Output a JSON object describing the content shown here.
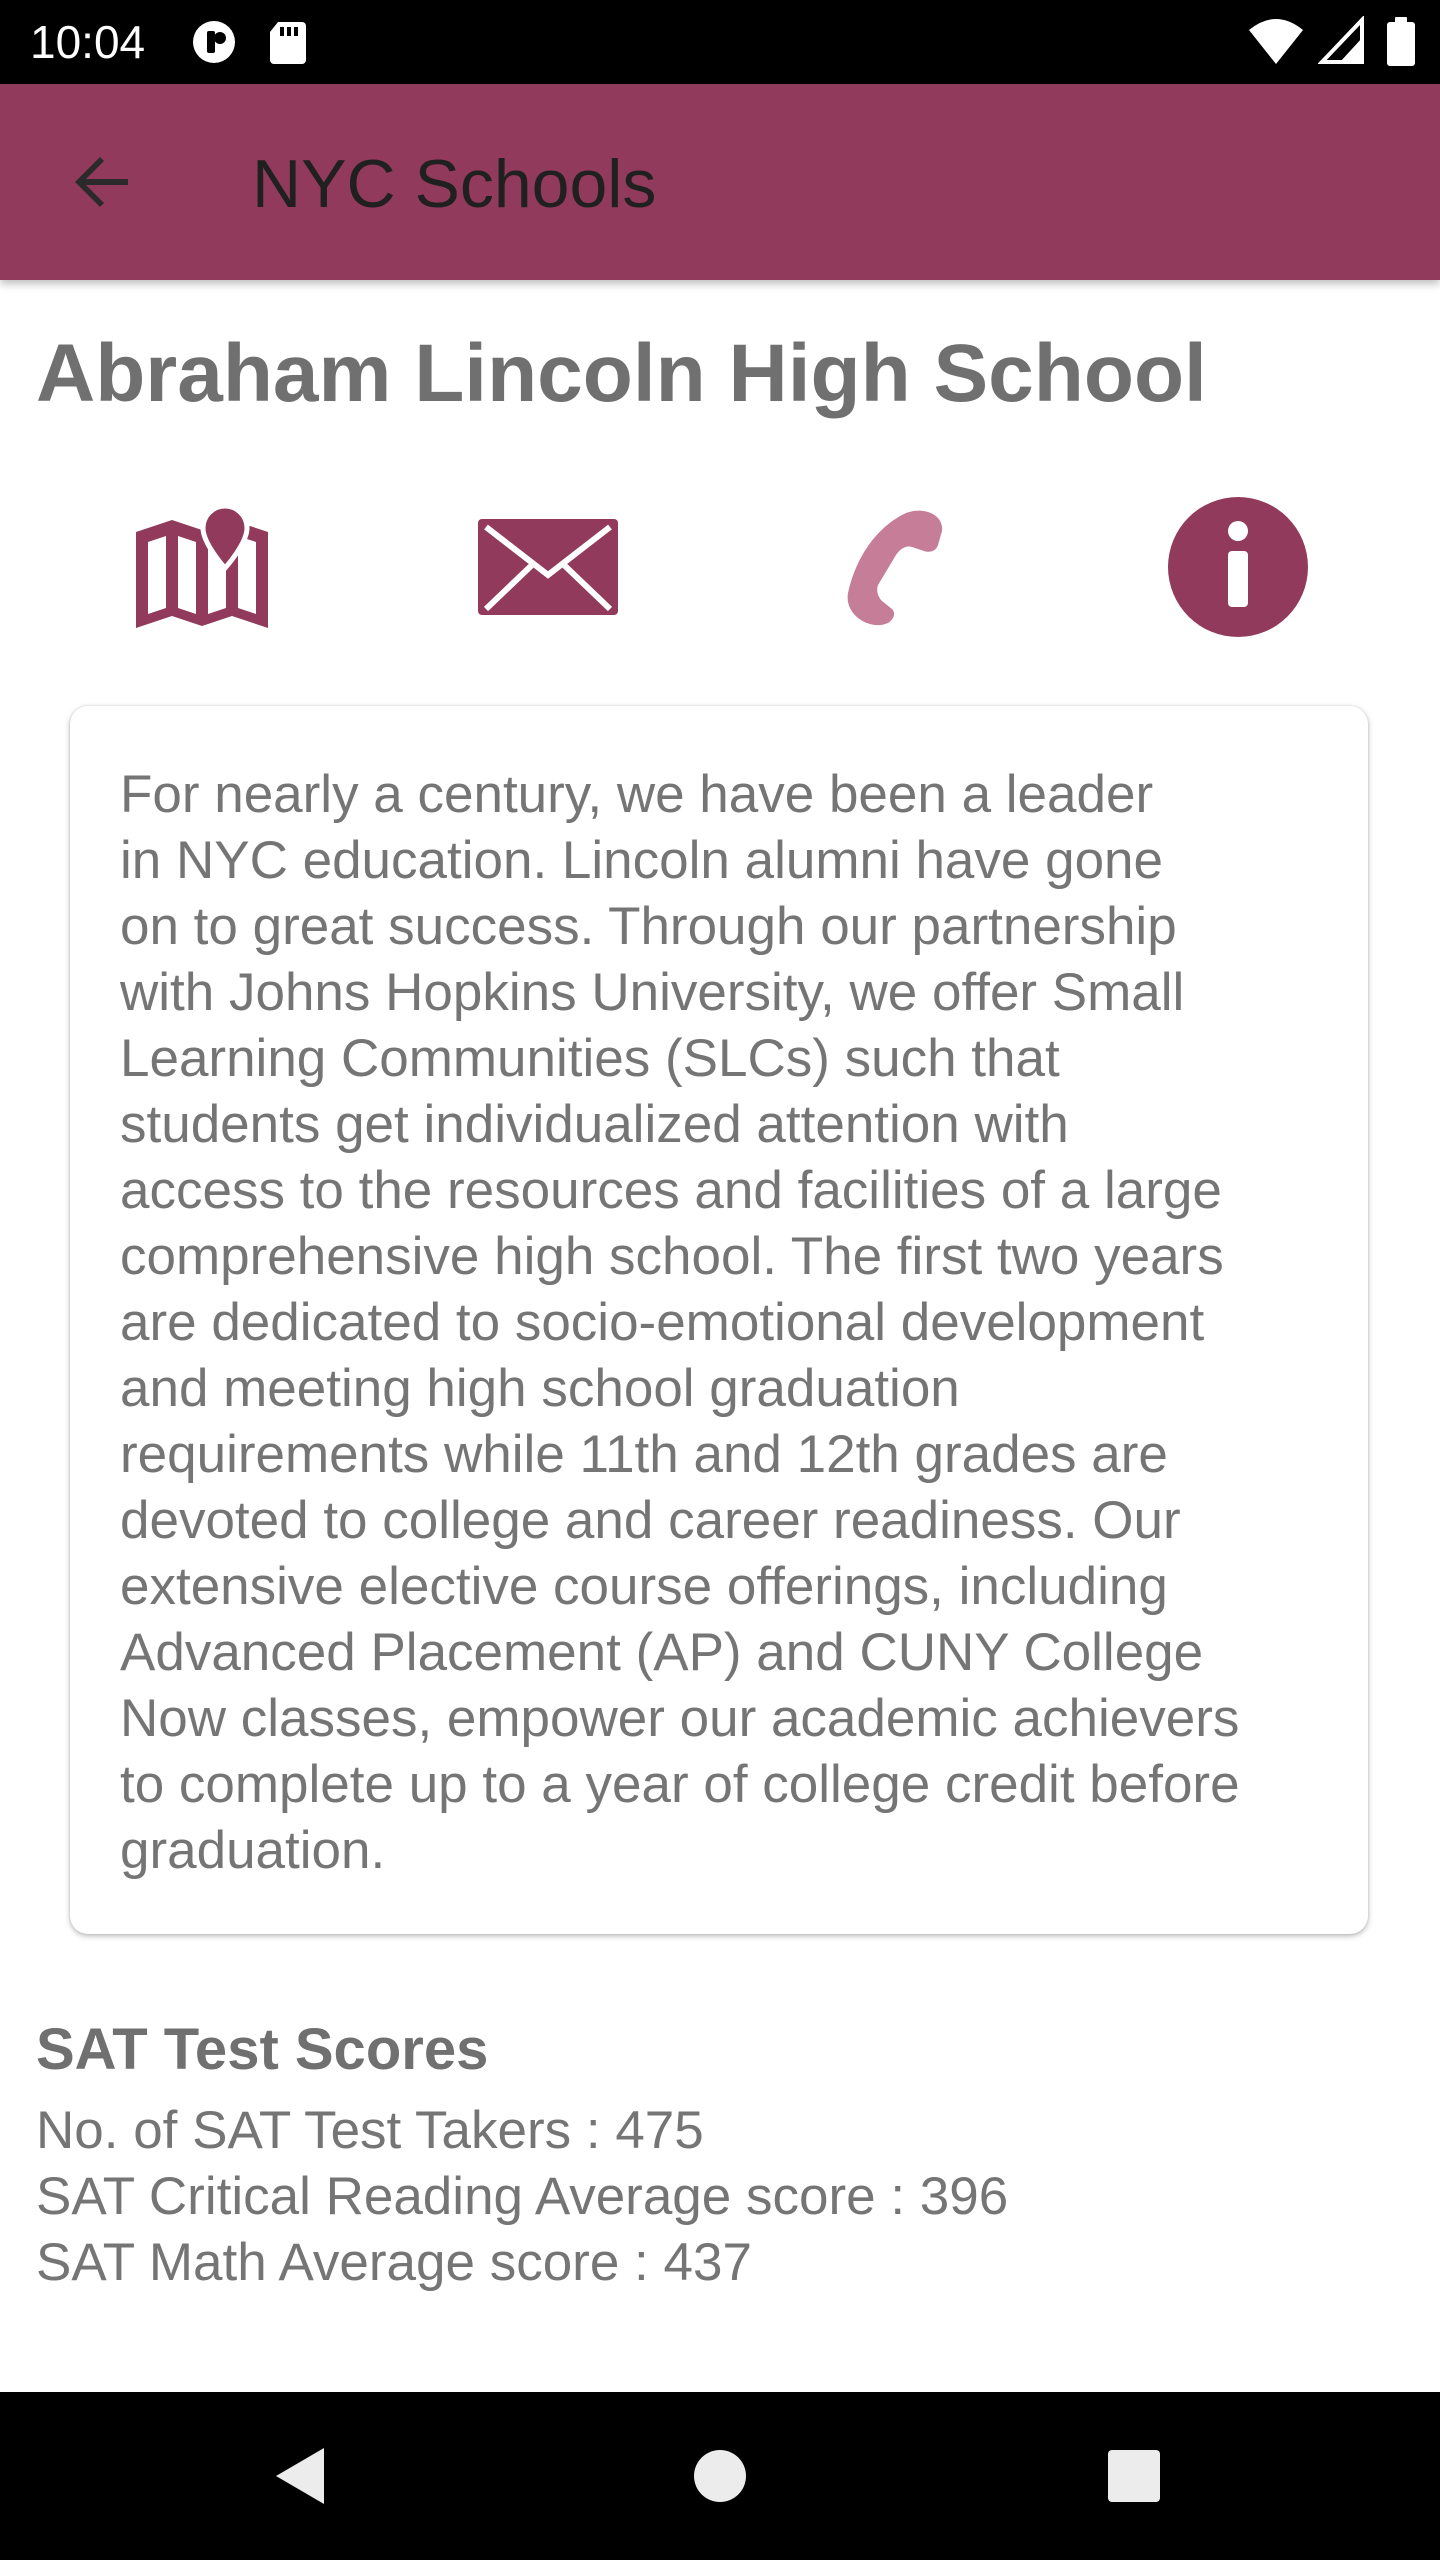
{
  "status_bar": {
    "time": "10:04",
    "left_icons": [
      "media-icon",
      "sd-card-icon"
    ],
    "right_icons": [
      "wifi-icon",
      "signal-icon",
      "battery-icon"
    ]
  },
  "app_bar": {
    "title": "NYC Schools",
    "back_icon": "arrow-back-icon",
    "background_color": "#923a5b"
  },
  "school": {
    "name": "Abraham Lincoln High School",
    "actions": [
      {
        "name": "map",
        "icon": "map-icon"
      },
      {
        "name": "email",
        "icon": "email-icon"
      },
      {
        "name": "phone",
        "icon": "phone-icon"
      },
      {
        "name": "info",
        "icon": "info-icon"
      }
    ],
    "overview_lines": [
      "For nearly a century, we have been a leader",
      "in NYC education. Lincoln alumni have gone",
      "on to great success. Through our partnership",
      "with Johns Hopkins University, we offer Small",
      "Learning Communities (SLCs) such that",
      "students get individualized attention with",
      "access to the resources and facilities of a large",
      "comprehensive high school. The first two years",
      "are dedicated to socio-emotional development",
      "and meeting high school graduation",
      "requirements while 11th and 12th grades are",
      "devoted to college and career readiness. Our",
      "extensive elective course offerings, including",
      "Advanced Placement (AP) and CUNY College",
      "Now classes, empower our academic achievers",
      "to complete up to a year of college credit before",
      "graduation."
    ]
  },
  "sat": {
    "heading": "SAT Test Scores",
    "test_takers": "No. of SAT Test Takers : 475",
    "critical_reading": "SAT Critical Reading Average score : 396",
    "math": "SAT Math Average score : 437"
  },
  "nav_bar": {
    "buttons": [
      "back-triangle-icon",
      "home-circle-icon",
      "recents-square-icon"
    ]
  },
  "colors": {
    "accent": "#923a5b",
    "accent_light": "#c57d98",
    "text_gray": "#757575"
  }
}
